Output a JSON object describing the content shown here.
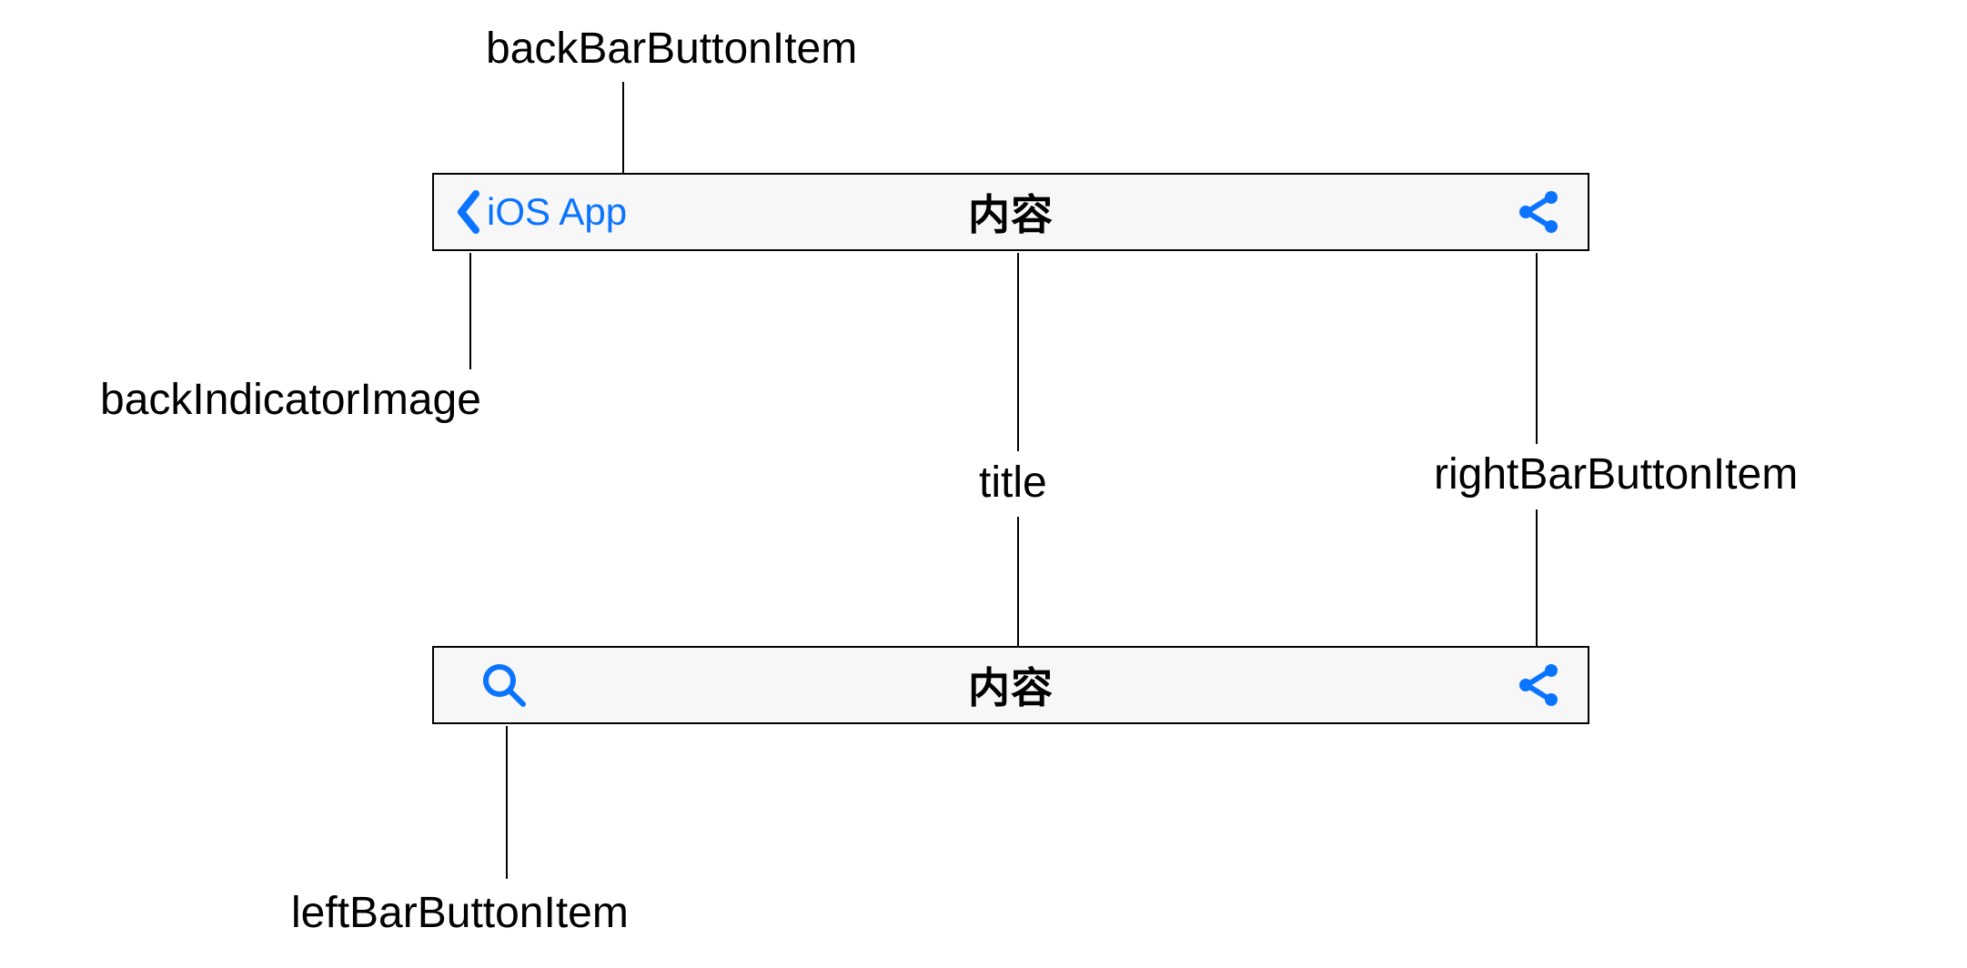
{
  "colors": {
    "tint": "#0a74ff",
    "navbar_bg": "#f7f7f8",
    "border": "#000000",
    "label": "#000000"
  },
  "labels": {
    "backBarButtonItem": "backBarButtonItem",
    "backIndicatorImage": "backIndicatorImage",
    "title": "title",
    "rightBarButtonItem": "rightBarButtonItem",
    "leftBarButtonItem": "leftBarButtonItem"
  },
  "navbar1": {
    "back_text": "iOS App",
    "title": "内容",
    "left_icon": "chevron-left-icon",
    "right_icon": "share-icon"
  },
  "navbar2": {
    "title": "内容",
    "left_icon": "search-icon",
    "right_icon": "share-icon"
  }
}
